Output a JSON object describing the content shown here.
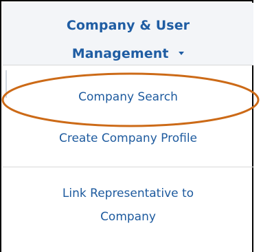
{
  "menu": {
    "title_line1": "Company & User",
    "title_line2": "Management",
    "items": [
      {
        "label": "Company Search"
      },
      {
        "label": "Create Company Profile"
      },
      {
        "label_line1": "Link Representative to",
        "label_line2": "Company"
      }
    ]
  },
  "highlight": {
    "color": "#cc6a17"
  }
}
